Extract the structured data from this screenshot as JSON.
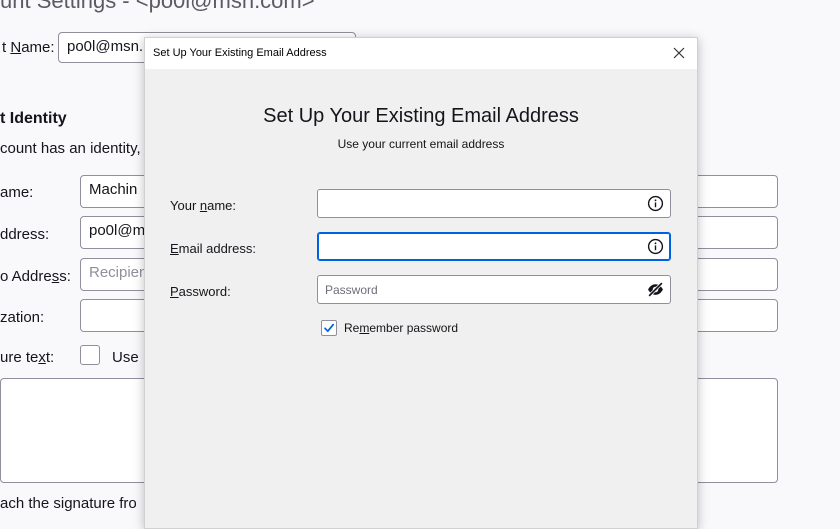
{
  "background": {
    "title": "unt Settings - <po0l@msn.com>",
    "account_name_label_pre": "t ",
    "account_name_label_u": "N",
    "account_name_label_post": "ame:",
    "account_name_value": "po0l@msn.",
    "identity_heading": "t Identity",
    "identity_desc": "count has an identity,",
    "name_label": "ame:",
    "name_value": "Machin",
    "address_label": "ddress:",
    "address_value": "po0l@m",
    "reply_label_pre": "o Addre",
    "reply_label_u": "s",
    "reply_label_post": "s:",
    "reply_placeholder": "Recipien",
    "org_label": "zation:",
    "sig_label_pre": "ure te",
    "sig_label_u": "x",
    "sig_label_post": "t:",
    "sig_use_label": "Use H",
    "attach_text": "ach the signature fro"
  },
  "dialog": {
    "window_title": "Set Up Your Existing Email Address",
    "heading": "Set Up Your Existing Email Address",
    "subheading": "Use your current email address",
    "name_label_pre": "Your ",
    "name_label_u": "n",
    "name_label_post": "ame:",
    "name_value": "",
    "email_label_u": "E",
    "email_label_post": "mail address:",
    "email_value": "",
    "password_label_u": "P",
    "password_label_post": "assword:",
    "password_placeholder": "Password",
    "remember_pre": "Re",
    "remember_u": "m",
    "remember_post": "ember password",
    "remember_checked": true
  },
  "icons": {
    "close": "close-icon",
    "info": "info-icon",
    "eye_slash": "eye-slash-icon",
    "check": "checkmark-icon"
  },
  "colors": {
    "accent": "#0061e0",
    "dialog_bg": "#f0f0f0",
    "page_bg": "#f9f9fb"
  }
}
